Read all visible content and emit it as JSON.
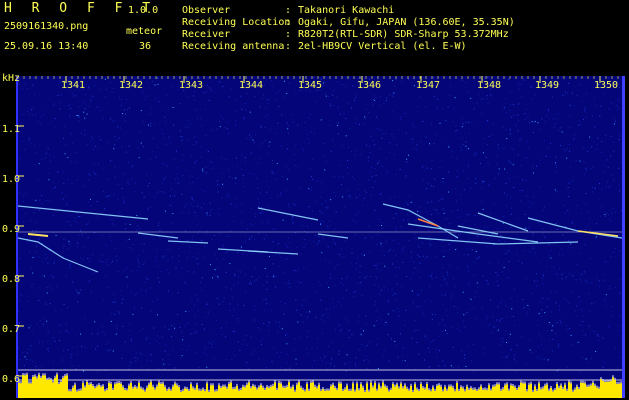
{
  "header": {
    "app_name": "H R O F F T",
    "version": "1.0.0",
    "filename": "2509161340.png",
    "meteor_label": "meteor",
    "timestamp": "25.09.16 13:40",
    "meteor_count": "36"
  },
  "station": {
    "rows": [
      {
        "key": "Observer",
        "value": "Takanori Kawachi"
      },
      {
        "key": "Receiving Location",
        "value": "Ogaki, Gifu, JAPAN (136.60E, 35.35N)"
      },
      {
        "key": "Receiver",
        "value": "R820T2(RTL-SDR) SDR-Sharp 53.372MHz"
      },
      {
        "key": "Receiving antenna",
        "value": "2el-HB9CV Vertical (el. E-W)"
      }
    ]
  },
  "spectrogram": {
    "y_unit": "kHz",
    "x_ticks": [
      "1341",
      "1342",
      "1343",
      "1344",
      "1345",
      "1346",
      "1347",
      "1348",
      "1349",
      "1350"
    ],
    "y_ticks": [
      "1.1",
      "1.0",
      "0.9",
      "0.8",
      "0.7",
      "0.6"
    ],
    "colors": {
      "background": "#05057a",
      "label": "#ffff55",
      "trace": "#8fd8ff",
      "hot": "#ffe060",
      "baseline": "#ffffff"
    }
  }
}
